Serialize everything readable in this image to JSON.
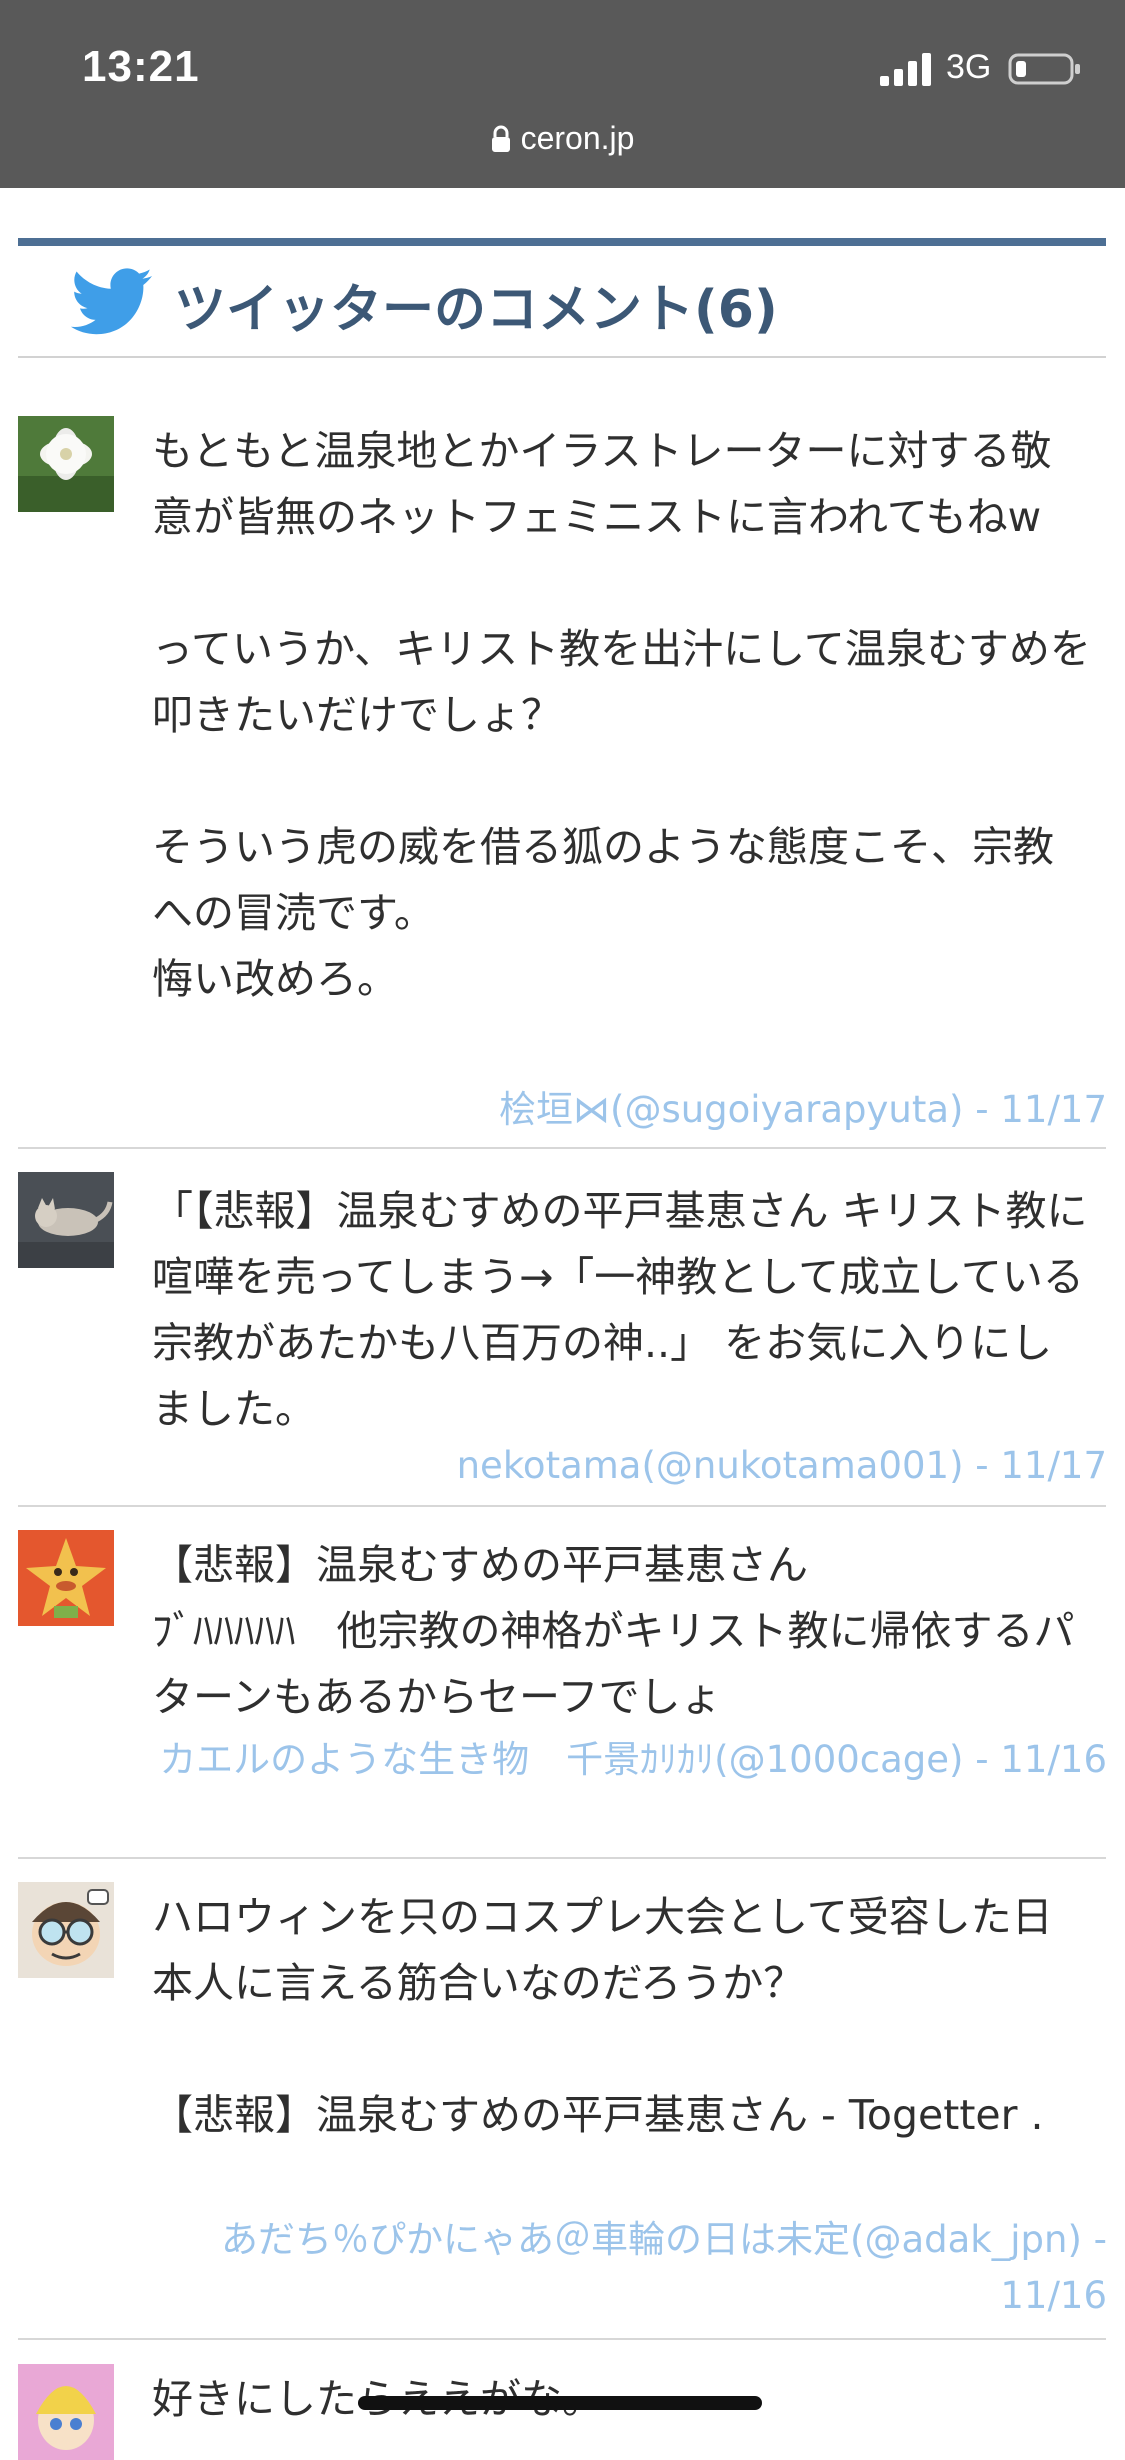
{
  "status_bar": {
    "time": "13:21",
    "network": "3G"
  },
  "browser": {
    "url": "ceron.jp"
  },
  "section": {
    "title": "ツイッターのコメント(6)"
  },
  "comments": [
    {
      "text": "もともと温泉地とかイラストレーターに対する敬意が皆無のネットフェミニストに言われてもねw\n\nっていうか、キリスト教を出汁にして温泉むすめを叩きたいだけでしょ？\n\nそういう虎の威を借る狐のような態度こそ、宗教への冒涜です。\n悔い改めろ。",
      "author": "桧垣⋈(@sugoiyarapyuta) - 11/17"
    },
    {
      "text": "「【悲報】温泉むすめの平戸基恵さん キリスト教に喧嘩を売ってしまう→「一神教として成立している宗教があたかも八百万の神..」 をお気に入りにしました。",
      "author": "nekotama(@nukotama001) - 11/17"
    },
    {
      "text": "【悲報】温泉むすめの平戸基恵さん\nﾌﾞﾊﾊﾊﾊﾊ　他宗教の神格がキリスト教に帰依するパターンもあるからセーフでしょ",
      "author": "カエルのような生き物　千景ｶﾘｶﾘ(@1000cage) - 11/16"
    },
    {
      "text": "ハロウィンを只のコスプレ大会として受容した日本人に言える筋合いなのだろうか？\n\n【悲報】温泉むすめの平戸基恵さん - Togetter .",
      "author": "あだち％ぴかにゃあ＠車輪の日は未定(@adak_jpn) - 11/16"
    },
    {
      "text": "好きにしたらええがな。",
      "author": ""
    }
  ]
}
